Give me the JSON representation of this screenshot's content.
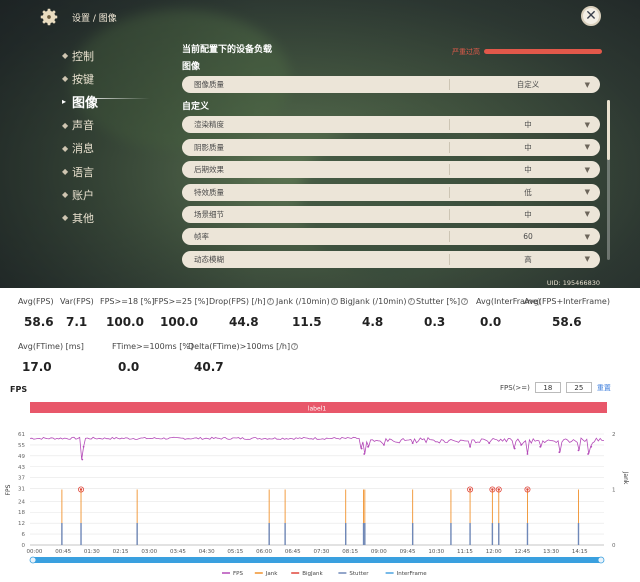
{
  "game": {
    "breadcrumb": "设置 / 图像",
    "nav": [
      {
        "label": "控制",
        "active": false
      },
      {
        "label": "按键",
        "active": false
      },
      {
        "label": "图像",
        "active": true
      },
      {
        "label": "声音",
        "active": false
      },
      {
        "label": "消息",
        "active": false
      },
      {
        "label": "语言",
        "active": false
      },
      {
        "label": "账户",
        "active": false
      },
      {
        "label": "其他",
        "active": false
      }
    ],
    "device_load_title": "当前配置下的设备负载",
    "device_load_status": "严重过高",
    "section_image": "图像",
    "section_custom": "自定义",
    "image_quality": {
      "label": "图像质量",
      "value": "自定义"
    },
    "settings": [
      {
        "label": "渲染精度",
        "value": "中"
      },
      {
        "label": "阴影质量",
        "value": "中"
      },
      {
        "label": "后期效果",
        "value": "中"
      },
      {
        "label": "特效质量",
        "value": "低"
      },
      {
        "label": "场景细节",
        "value": "中"
      },
      {
        "label": "帧率",
        "value": "60"
      },
      {
        "label": "动态模糊",
        "value": "高"
      }
    ],
    "uid": "UID: 195466830"
  },
  "stats_row1": [
    {
      "label": "Avg(FPS)",
      "value": "58.6",
      "help": false
    },
    {
      "label": "Var(FPS)",
      "value": "7.1",
      "help": false
    },
    {
      "label": "FPS>=18 [%]",
      "value": "100.0",
      "help": false
    },
    {
      "label": "FPS>=25 [%]",
      "value": "100.0",
      "help": false
    },
    {
      "label": "Drop(FPS) [/h]",
      "value": "44.8",
      "help": true
    },
    {
      "label": "Jank (/10min)",
      "value": "11.5",
      "help": true
    },
    {
      "label": "BigJank (/10min)",
      "value": "4.8",
      "help": true
    },
    {
      "label": "Stutter [%]",
      "value": "0.3",
      "help": true
    },
    {
      "label": "Avg(InterFrame)",
      "value": "0.0",
      "help": false
    },
    {
      "label": "Avg(FPS+InterFrame)",
      "value": "58.6",
      "help": false
    }
  ],
  "stats_row2": [
    {
      "label": "Avg(FTime) [ms]",
      "value": "17.0",
      "help": false
    },
    {
      "label": "FTime>=100ms [%]",
      "value": "0.0",
      "help": false
    },
    {
      "label": "Delta(FTime)>100ms [/h]",
      "value": "40.7",
      "help": true
    }
  ],
  "chart_controls": {
    "title": "FPS",
    "threshold_label": "FPS(>=)",
    "threshold_1": "18",
    "threshold_2": "25",
    "reset": "重置"
  },
  "chart_data": {
    "type": "line",
    "title": "FPS",
    "band_label": "label1",
    "ylabel": "FPS",
    "y2label": "Jank",
    "ylim": [
      0,
      61
    ],
    "yticks": [
      0,
      6,
      12,
      18,
      24,
      31,
      37,
      43,
      49,
      55,
      61
    ],
    "y2lim": [
      0,
      2
    ],
    "y2ticks": [
      0,
      1,
      2
    ],
    "xlim_seconds": [
      0,
      900
    ],
    "xticks": [
      "00:00",
      "00:45",
      "01:30",
      "02:15",
      "03:00",
      "03:45",
      "04:30",
      "05:15",
      "06:00",
      "06:45",
      "07:30",
      "08:15",
      "09:00",
      "09:45",
      "10:30",
      "11:15",
      "12:00",
      "12:45",
      "13:30",
      "14:15"
    ],
    "fps_series": {
      "name": "FPS",
      "color": "#b44ab8",
      "baseline": 58.6,
      "dips": [
        {
          "t": 82,
          "fps": 47
        },
        {
          "t": 84,
          "fps": 54
        },
        {
          "t": 520,
          "fps": 53
        },
        {
          "t": 524,
          "fps": 50
        },
        {
          "t": 530,
          "fps": 54
        },
        {
          "t": 555,
          "fps": 55
        },
        {
          "t": 600,
          "fps": 56
        },
        {
          "t": 690,
          "fps": 54
        },
        {
          "t": 720,
          "fps": 56
        },
        {
          "t": 760,
          "fps": 53
        },
        {
          "t": 770,
          "fps": 55
        },
        {
          "t": 780,
          "fps": 50
        },
        {
          "t": 800,
          "fps": 54
        },
        {
          "t": 830,
          "fps": 51
        },
        {
          "t": 860,
          "fps": 52
        },
        {
          "t": 875,
          "fps": 50
        },
        {
          "t": 880,
          "fps": 54
        }
      ]
    },
    "jank_events": [
      {
        "t": 50,
        "big": false
      },
      {
        "t": 80,
        "big": true
      },
      {
        "t": 168,
        "big": false
      },
      {
        "t": 375,
        "big": false
      },
      {
        "t": 400,
        "big": false
      },
      {
        "t": 495,
        "big": false
      },
      {
        "t": 523,
        "big": false
      },
      {
        "t": 525,
        "big": false
      },
      {
        "t": 600,
        "big": false
      },
      {
        "t": 660,
        "big": false
      },
      {
        "t": 690,
        "big": true
      },
      {
        "t": 725,
        "big": true
      },
      {
        "t": 735,
        "big": true
      },
      {
        "t": 780,
        "big": true
      },
      {
        "t": 860,
        "big": false
      }
    ],
    "legend": [
      {
        "name": "FPS",
        "color": "#b44ab8"
      },
      {
        "name": "Jank",
        "color": "#f0922e"
      },
      {
        "name": "BigJank",
        "color": "#e0463a"
      },
      {
        "name": "Stutter",
        "color": "#6f88b8"
      },
      {
        "name": "InterFrame",
        "color": "#4aa3e0"
      }
    ]
  }
}
